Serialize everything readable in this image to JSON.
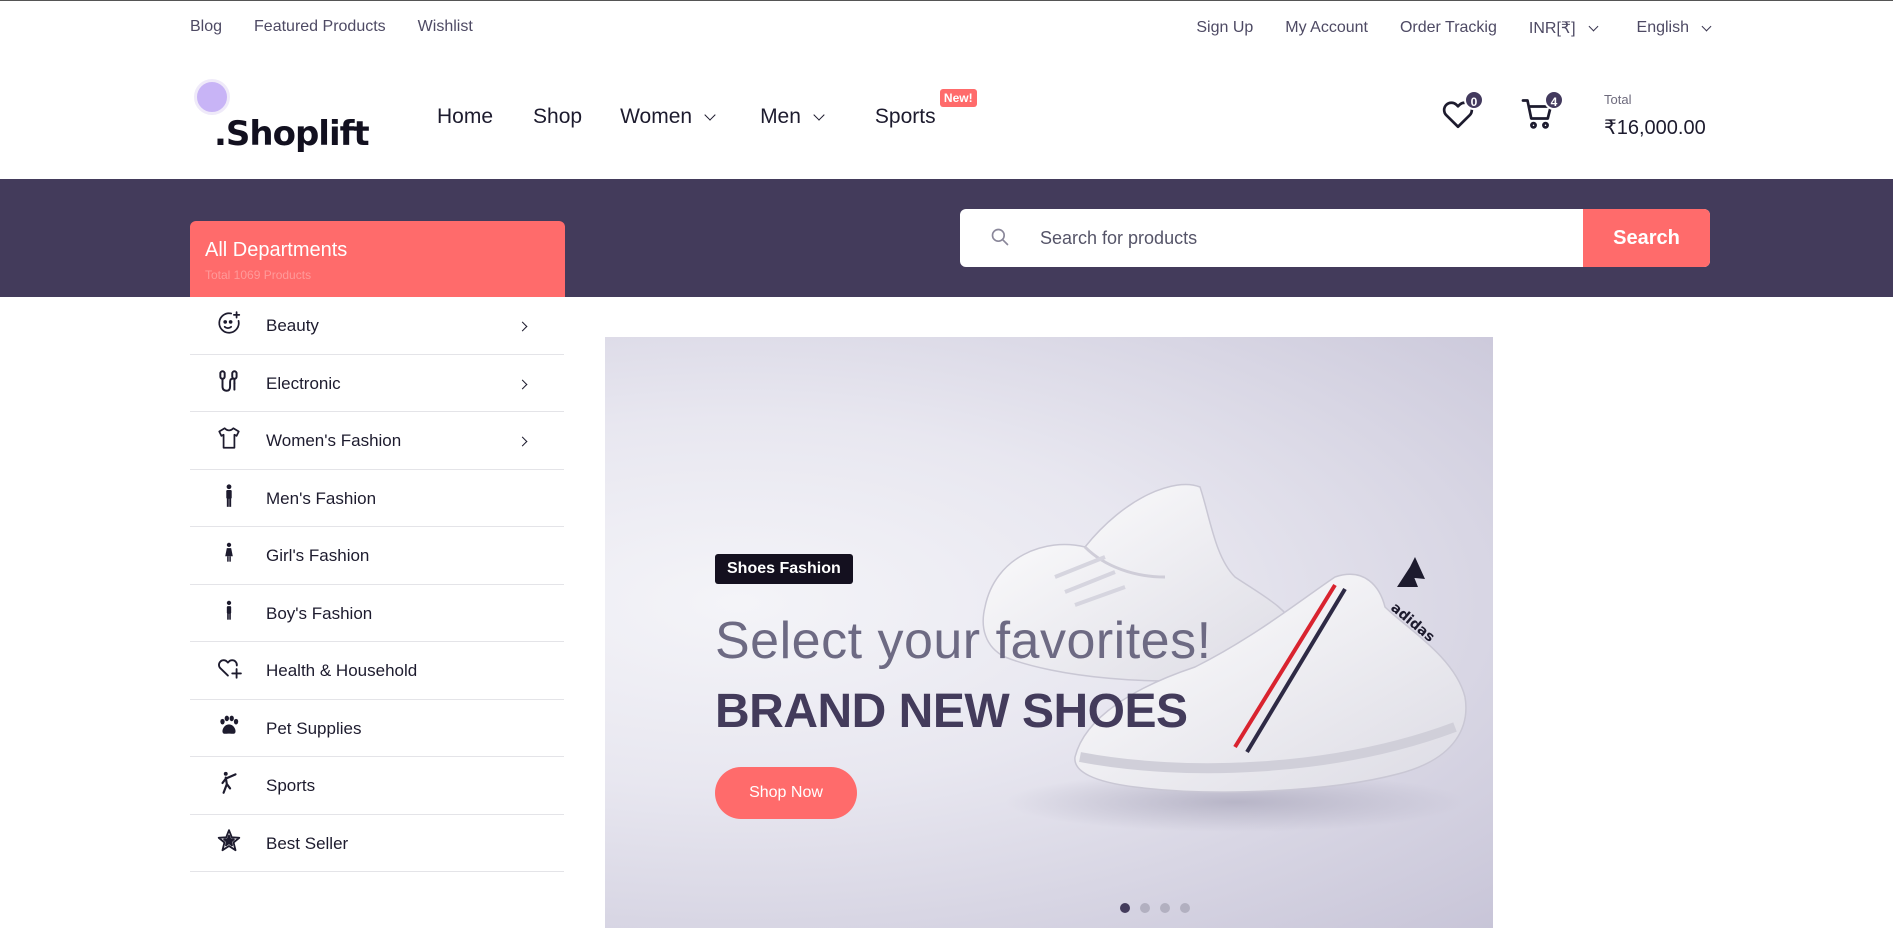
{
  "topbar": {
    "left_links": [
      "Blog",
      "Featured Products",
      "Wishlist"
    ],
    "sign_up": "Sign Up",
    "my_account": "My Account",
    "order_tracking": "Order Trackig",
    "currency": "INR[₹]",
    "language": "English"
  },
  "logo": {
    "text": ".Shoplift"
  },
  "nav": {
    "home": "Home",
    "shop": "Shop",
    "women": "Women",
    "men": "Men",
    "sports": "Sports",
    "new_badge": "New!"
  },
  "header": {
    "wishlist_count": "0",
    "cart_count": "4",
    "total_label": "Total",
    "total_value": "₹16,000.00"
  },
  "departments": {
    "title": "All Departments",
    "subtitle": "Total 1069 Products",
    "items": [
      {
        "label": "Beauty",
        "icon": "beauty-icon",
        "has_submenu": true
      },
      {
        "label": "Electronic",
        "icon": "electronic-icon",
        "has_submenu": true
      },
      {
        "label": "Women's Fashion",
        "icon": "women-fashion-icon",
        "has_submenu": true
      },
      {
        "label": "Men's Fashion",
        "icon": "man-icon",
        "has_submenu": false
      },
      {
        "label": "Girl's Fashion",
        "icon": "girl-icon",
        "has_submenu": false
      },
      {
        "label": "Boy's Fashion",
        "icon": "boy-icon",
        "has_submenu": false
      },
      {
        "label": "Health & Household",
        "icon": "heart-plus-icon",
        "has_submenu": false
      },
      {
        "label": "Pet Supplies",
        "icon": "paw-icon",
        "has_submenu": false
      },
      {
        "label": "Sports",
        "icon": "sports-icon",
        "has_submenu": false
      },
      {
        "label": "Best Seller",
        "icon": "star-icon",
        "has_submenu": false
      }
    ]
  },
  "search": {
    "placeholder": "Search for products",
    "button": "Search"
  },
  "hero": {
    "tag": "Shoes Fashion",
    "subtitle": "Select your favorites!",
    "title": "BRAND NEW SHOES",
    "button": "Shop Now",
    "slide_count": 4,
    "active_slide": 1
  },
  "colors": {
    "accent": "#ff6b6b",
    "brand_purple": "#433b5b",
    "dark": "#14101f"
  }
}
